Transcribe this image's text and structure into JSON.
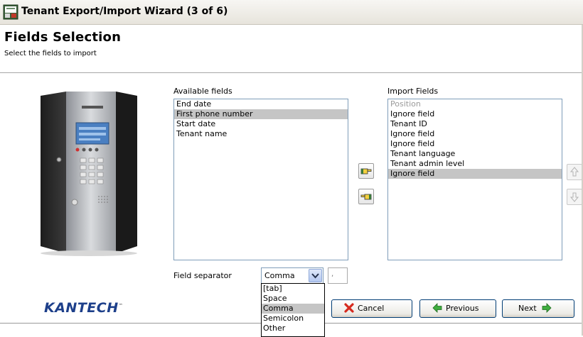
{
  "window": {
    "title": "Tenant Export/Import Wizard (3 of 6)"
  },
  "header": {
    "title": "Fields Selection",
    "subtitle": "Select the fields to import"
  },
  "available": {
    "label": "Available fields",
    "items": [
      "End date",
      "First phone number",
      "Start date",
      "Tenant name"
    ],
    "selected_index": 1
  },
  "import": {
    "label": "Import Fields",
    "items": [
      "Position",
      "Ignore field",
      "Tenant ID",
      "Ignore field",
      "Ignore field",
      "Tenant language",
      "Tenant admin level",
      "Ignore field"
    ],
    "disabled_index": 0,
    "selected_index": 7
  },
  "separator": {
    "label": "Field separator",
    "value": "Comma",
    "preview": ",",
    "options": [
      "[tab]",
      "Space",
      "Comma",
      "Semicolon",
      "Other"
    ],
    "selected_option_index": 2
  },
  "logo": {
    "text": "KANTECH",
    "mark": "™"
  },
  "buttons": {
    "cancel": "Cancel",
    "previous": "Previous",
    "next": "Next"
  },
  "icons": {
    "add": "pointing-hand-right-icon",
    "remove": "pointing-hand-left-icon",
    "up": "arrow-up-icon",
    "down": "arrow-down-icon",
    "cancel": "red-x-icon",
    "previous": "green-arrow-left-icon",
    "next": "green-arrow-right-icon"
  },
  "colors": {
    "selection": "#c5c5c5",
    "logo": "#1d3f8a",
    "list_border": "#7f9db9",
    "arrow_green": "#3fae3f",
    "cancel_red": "#d62b1f"
  }
}
